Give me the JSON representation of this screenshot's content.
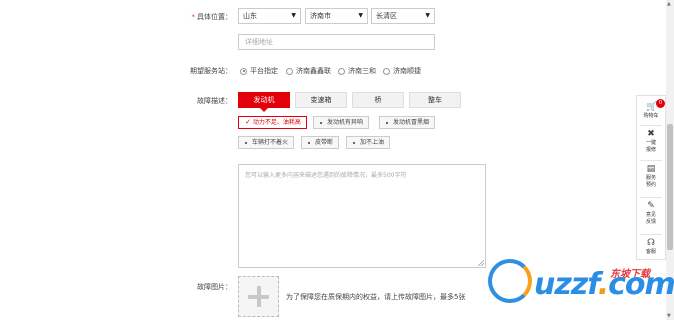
{
  "location": {
    "label": "具体位置：",
    "required_mark": "*",
    "province": "山东",
    "city": "济南市",
    "district": "长清区",
    "address_placeholder": "详细地址"
  },
  "service_station": {
    "label": "期望服务站：",
    "options": [
      {
        "label": "平台指定",
        "checked": true
      },
      {
        "label": "济南鑫鑫联",
        "checked": false
      },
      {
        "label": "济南三和",
        "checked": false
      },
      {
        "label": "济南顺捷",
        "checked": false
      }
    ]
  },
  "fault": {
    "label": "故障描述：",
    "categories": [
      {
        "label": "发动机",
        "active": true
      },
      {
        "label": "变速箱",
        "active": false
      },
      {
        "label": "桥",
        "active": false
      },
      {
        "label": "整车",
        "active": false
      }
    ],
    "tags_row1": [
      {
        "label": "动力不足、油耗高",
        "selected": true
      },
      {
        "label": "发动机有异响",
        "selected": false
      },
      {
        "label": "发动机冒黑烟",
        "selected": false
      }
    ],
    "tags_row2": [
      {
        "label": "车辆打不着火",
        "selected": false
      },
      {
        "label": "皮带断",
        "selected": false
      },
      {
        "label": "加不上油",
        "selected": false
      }
    ],
    "textarea_placeholder": "您可以输入更多内容来描述您遇到的故障情况，最多500字符"
  },
  "images": {
    "label": "故障图片：",
    "note": "为了保障您在质保期内的权益，请上传故障图片，最多5张"
  },
  "sidebar": {
    "cart_label": "购物车",
    "cart_count": "0",
    "repair_label_1": "一键",
    "repair_label_2": "报修",
    "booking_label_1": "服务",
    "booking_label_2": "预约",
    "feedback_label_1": "意见",
    "feedback_label_2": "反馈",
    "service_label": "客服"
  },
  "watermark": {
    "main": "uzzf",
    "dot": ".",
    "com": "com",
    "tagline": "东坡下载"
  },
  "colors": {
    "accent": "#e4000a",
    "border": "#cccccc",
    "watermark_blue": "#2b8ee6",
    "watermark_orange": "#f39a1e"
  }
}
